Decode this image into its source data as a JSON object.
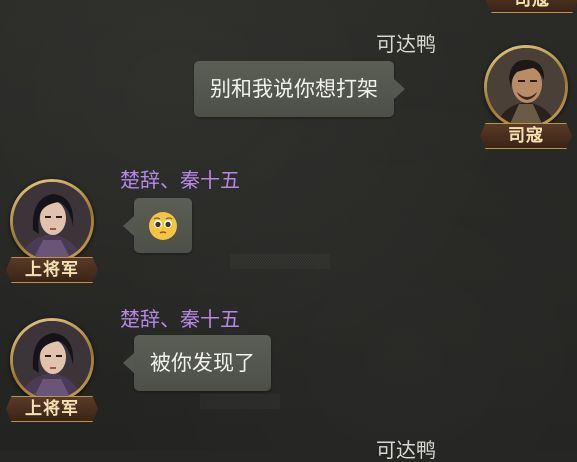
{
  "chat": {
    "top_partial_rank": "司寇",
    "messages": [
      {
        "side": "right",
        "sender": "可达鸭",
        "text": "别和我说你想打架",
        "rank": "司寇"
      },
      {
        "side": "left",
        "sender": "楚辞、秦十五",
        "emoji": "pleading-face",
        "rank": "上将军"
      },
      {
        "side": "left",
        "sender": "楚辞、秦十五",
        "text": "被你发现了",
        "rank": "上将军"
      }
    ],
    "bottom_partial_sender": "可达鸭"
  },
  "colors": {
    "background": "#262624",
    "bubble": "#55584f",
    "sender_purple": "#b489e6",
    "sender_white": "#d8d8d2",
    "rank_text": "#f4e2b3",
    "rank_bg": "#4a2e1e",
    "avatar_ring": "#c8a55a"
  }
}
